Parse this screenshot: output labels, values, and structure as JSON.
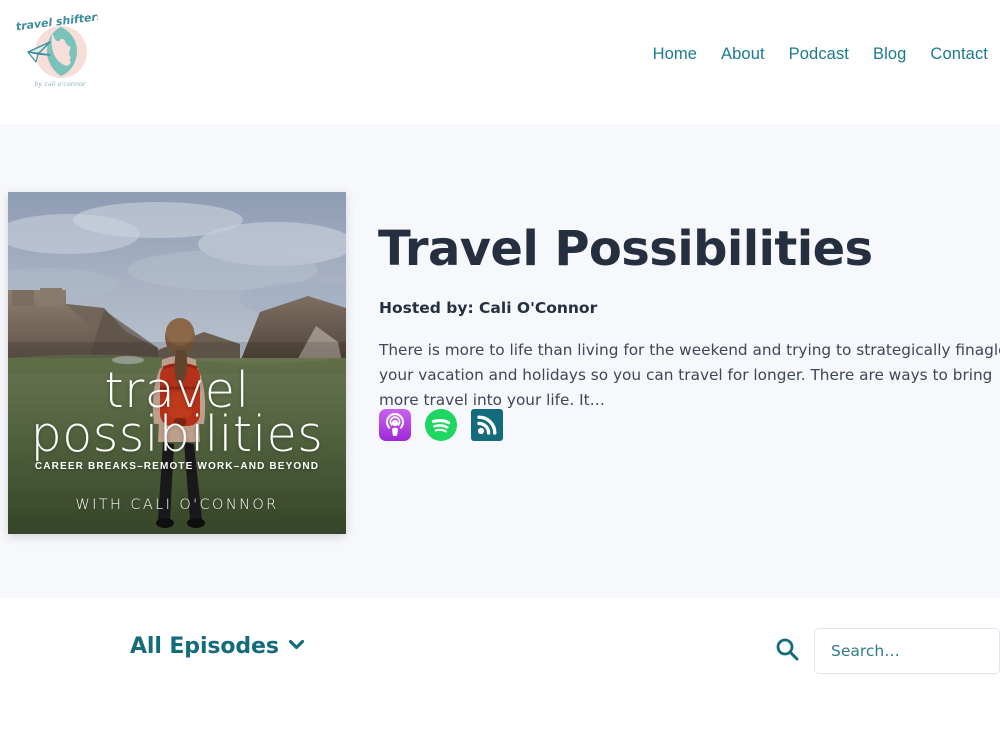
{
  "brand": {
    "logo_line1": "travel shifters",
    "logo_line2": "by cali o'connor",
    "teal": "#1a7b8c",
    "blush": "#f6dcd6",
    "globe_green": "#7cc4bd"
  },
  "nav": {
    "items": [
      {
        "label": "Home"
      },
      {
        "label": "About"
      },
      {
        "label": "Podcast"
      },
      {
        "label": "Blog"
      },
      {
        "label": "Contact"
      }
    ]
  },
  "hero": {
    "background": "#f7f8fb",
    "title": "Travel Possibilities",
    "hosted_by": "Hosted by: Cali O'Connor",
    "description": "There is more to life than living for the weekend and trying to strategically finagle your vacation and holidays so you can travel for longer. There are ways to bring more travel into your life. It…",
    "cover_art": {
      "alt": "Woman with red backpack facing ancient stone ruins across a green field",
      "overlay_line_1": "travel",
      "overlay_line_2": "possibilities",
      "overlay_tagline": "CAREER BREAKS–REMOTE WORK–AND BEYOND",
      "overlay_credit": "WITH CALI O'CONNOR"
    },
    "listen_links": [
      {
        "name": "apple-podcasts-icon",
        "label": "Apple Podcasts",
        "color": "#B150E2"
      },
      {
        "name": "spotify-icon",
        "label": "Spotify",
        "color": "#1ED760"
      },
      {
        "name": "rss-icon",
        "label": "RSS Feed",
        "color": "#136b7c"
      }
    ]
  },
  "episodes": {
    "filter_label": "All Episodes",
    "filter_icon": "chevron-down-icon",
    "search_icon": "search-icon",
    "search_placeholder": "Search…",
    "search_value": ""
  }
}
